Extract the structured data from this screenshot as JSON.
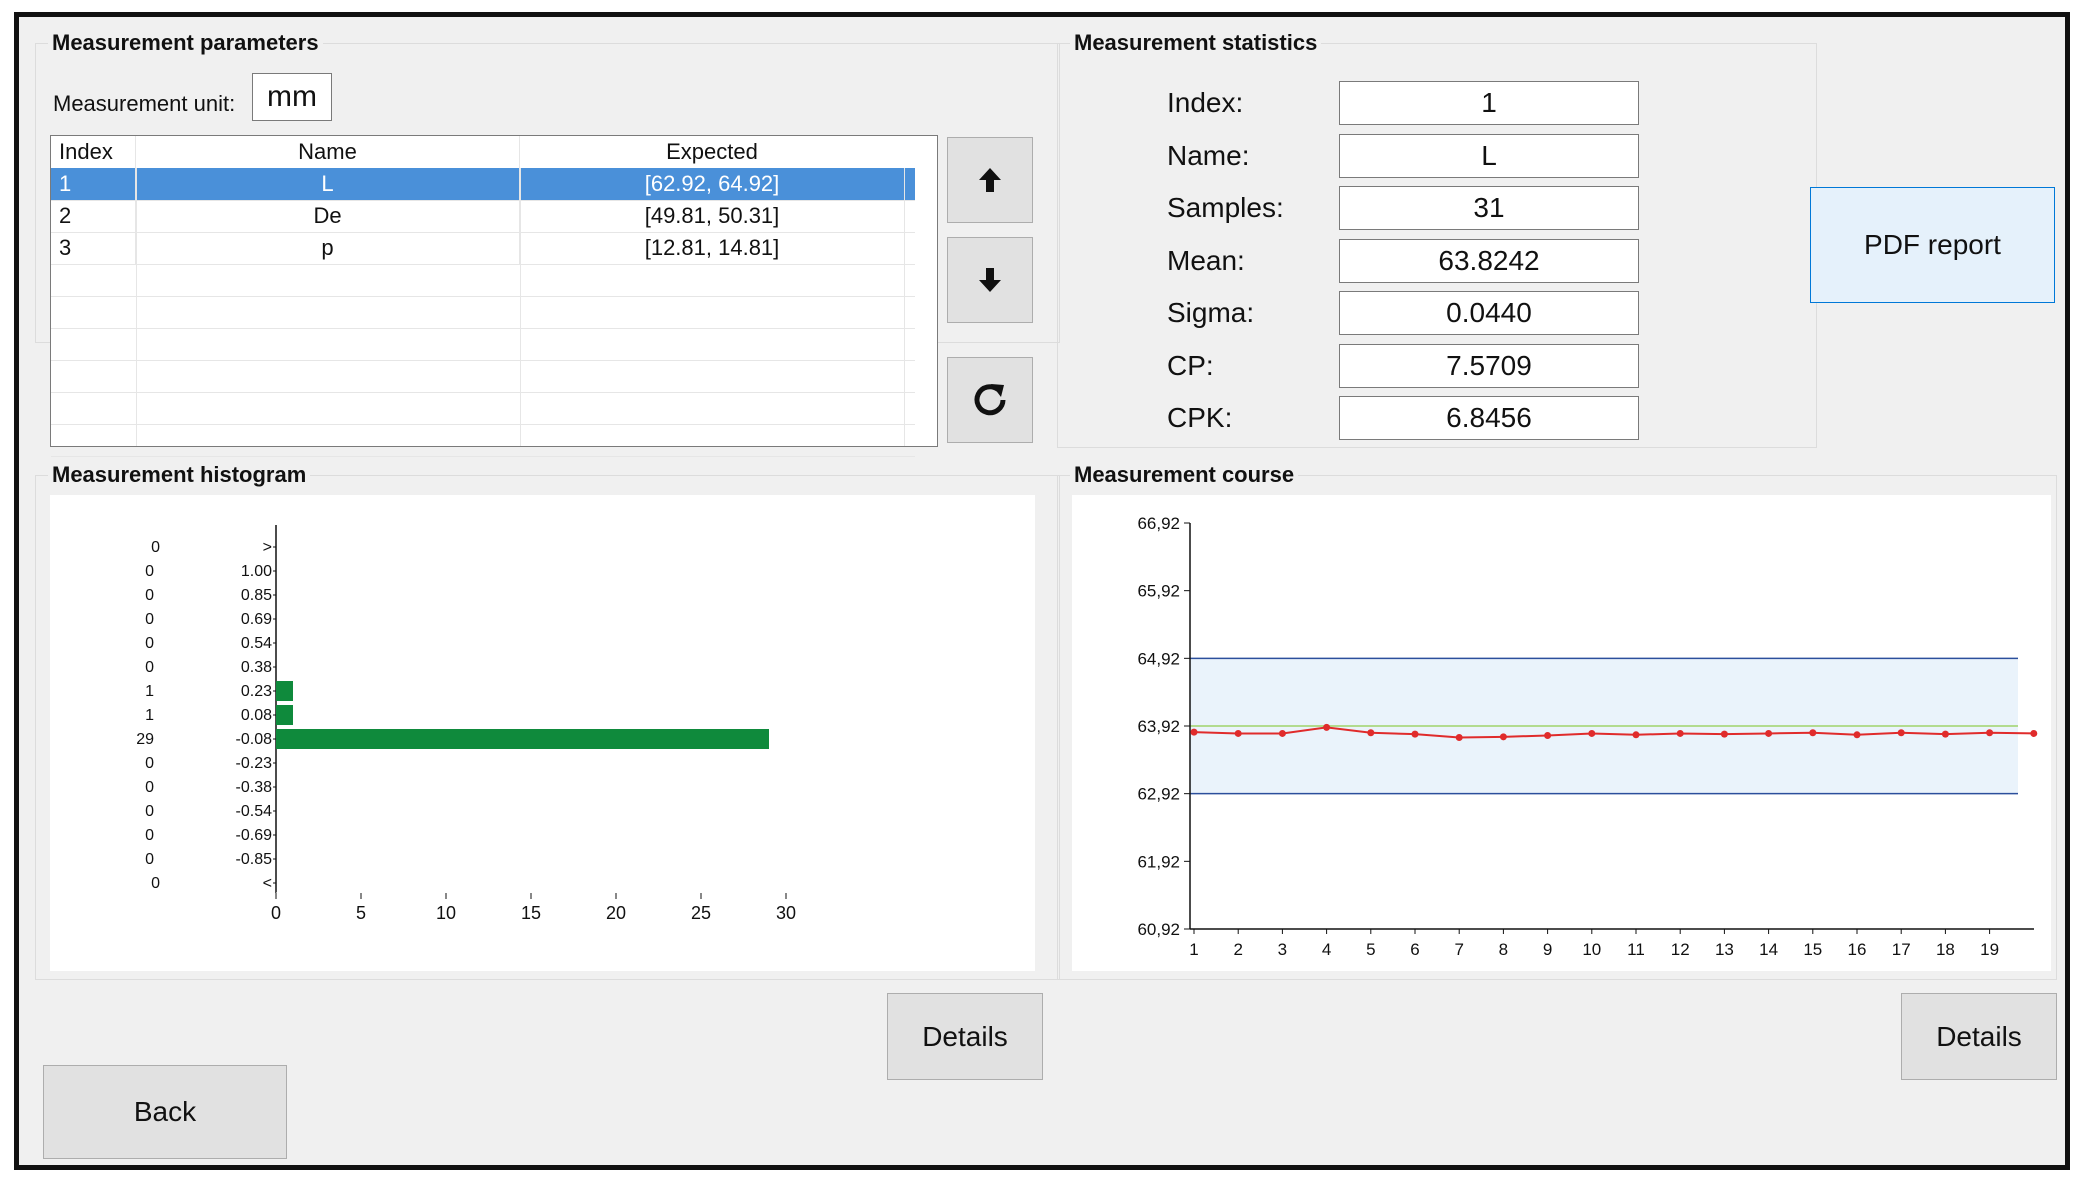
{
  "params": {
    "title": "Measurement parameters",
    "unit_label": "Measurement unit:",
    "unit_value": "mm",
    "columns": [
      "Index",
      "Name",
      "Expected"
    ],
    "rows": [
      {
        "index": "1",
        "name": "L",
        "expected": "[62.92, 64.92]"
      },
      {
        "index": "2",
        "name": "De",
        "expected": "[49.81, 50.31]"
      },
      {
        "index": "3",
        "name": "p",
        "expected": "[12.81, 14.81]"
      }
    ],
    "selected_row": 0,
    "icons": {
      "up": "arrow-up-icon",
      "down": "arrow-down-icon",
      "refresh": "refresh-icon"
    }
  },
  "stats": {
    "title": "Measurement statistics",
    "items": [
      {
        "label": "Index:",
        "value": "1"
      },
      {
        "label": "Name:",
        "value": "L"
      },
      {
        "label": "Samples:",
        "value": "31"
      },
      {
        "label": "Mean:",
        "value": "63.8242"
      },
      {
        "label": "Sigma:",
        "value": "0.0440"
      },
      {
        "label": "CP:",
        "value": "7.5709"
      },
      {
        "label": "CPK:",
        "value": "6.8456"
      }
    ]
  },
  "pdf_button": "PDF report",
  "details_label": "Details",
  "back_label": "Back",
  "histogram": {
    "title": "Measurement histogram"
  },
  "course": {
    "title": "Measurement course"
  },
  "colors": {
    "bar": "#0f8a3c",
    "limit": "#2b4f9c",
    "band": "#eaf3fb",
    "mean": "#9fd36b",
    "series": "#e02b2b",
    "selection": "#4a90d9"
  },
  "chart_data": [
    {
      "type": "bar",
      "orientation": "horizontal",
      "categories": [
        ">",
        "1.00",
        "0.85",
        "0.69",
        "0.54",
        "0.38",
        "0.23",
        "0.08",
        "-0.08",
        "-0.23",
        "-0.38",
        "-0.54",
        "-0.69",
        "-0.85",
        "<"
      ],
      "values": [
        0,
        0,
        0,
        0,
        0,
        0,
        1,
        1,
        29,
        0,
        0,
        0,
        0,
        0,
        0
      ],
      "count_labels": [
        "0",
        "0",
        "0",
        "0",
        "0",
        "0",
        "1",
        "1",
        "29",
        "0",
        "0",
        "0",
        "0",
        "0",
        "0"
      ],
      "xlim": [
        0,
        30
      ],
      "xticks": [
        "0",
        "5",
        "10",
        "15",
        "20",
        "25",
        "30"
      ]
    },
    {
      "type": "line",
      "x": [
        1,
        2,
        3,
        4,
        5,
        6,
        7,
        8,
        9,
        10,
        11,
        12,
        13,
        14,
        15,
        16,
        17,
        18,
        19,
        20
      ],
      "values": [
        63.83,
        63.81,
        63.81,
        63.9,
        63.82,
        63.8,
        63.75,
        63.76,
        63.78,
        63.81,
        63.79,
        63.81,
        63.8,
        63.81,
        63.82,
        63.79,
        63.82,
        63.8,
        63.82,
        63.81
      ],
      "xticks": [
        "1",
        "2",
        "3",
        "4",
        "5",
        "6",
        "7",
        "8",
        "9",
        "10",
        "11",
        "12",
        "13",
        "14",
        "15",
        "16",
        "17",
        "18",
        "19"
      ],
      "yticks": [
        "66,92",
        "65,92",
        "64,92",
        "63,92",
        "62,92",
        "61,92",
        "60,92"
      ],
      "ylim": [
        60.92,
        66.92
      ],
      "upper_limit": 64.92,
      "lower_limit": 62.92,
      "mean": 63.92
    }
  ]
}
